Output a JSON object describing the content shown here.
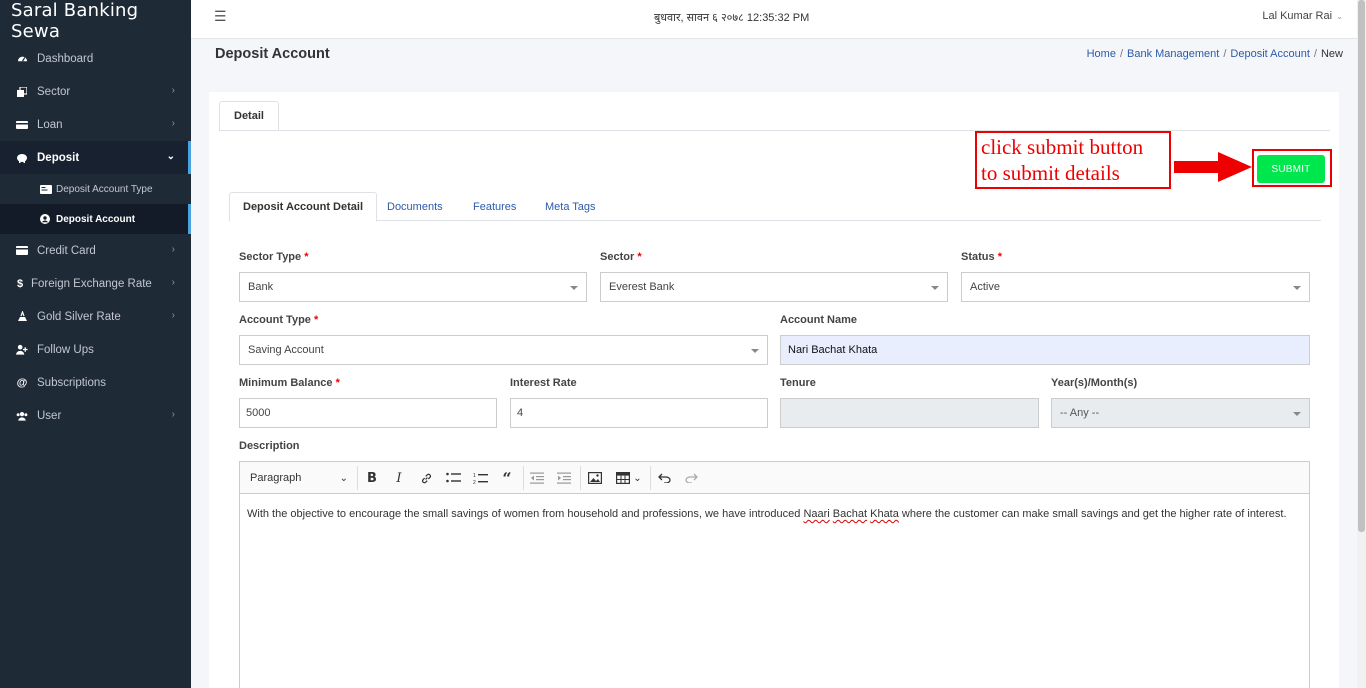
{
  "app": {
    "brand": "Saral Banking Sewa"
  },
  "sidebar": {
    "items": [
      {
        "label": "Dashboard",
        "icon": "dashboard-icon"
      },
      {
        "label": "Sector",
        "icon": "sector-icon"
      },
      {
        "label": "Loan",
        "icon": "loan-icon"
      },
      {
        "label": "Deposit",
        "icon": "piggy-bank-icon",
        "open": true
      },
      {
        "label": "Credit Card",
        "icon": "credit-card-icon"
      },
      {
        "label": "Foreign Exchange Rate",
        "icon": "dollar-icon"
      },
      {
        "label": "Gold Silver Rate",
        "icon": "gold-icon"
      },
      {
        "label": "Follow Ups",
        "icon": "user-plus-icon"
      },
      {
        "label": "Subscriptions",
        "icon": "at-icon"
      },
      {
        "label": "User",
        "icon": "users-icon"
      }
    ],
    "sub_items": [
      {
        "label": "Deposit Account Type",
        "icon": "card-icon"
      },
      {
        "label": "Deposit Account",
        "icon": "user-circle-icon",
        "active": true
      }
    ]
  },
  "topbar": {
    "datetime": "बुधवार, सावन ६ २०७८ 12:35:32 PM",
    "user": "Lal Kumar Rai"
  },
  "page": {
    "title": "Deposit Account",
    "breadcrumb": [
      "Home",
      "Bank Management",
      "Deposit Account",
      "New"
    ]
  },
  "card": {
    "top_tab": "Detail",
    "annotation": {
      "line1": "click  submit  button",
      "line2": "to  submit  details"
    },
    "submit_label": "SUBMIT",
    "tabs": [
      "Deposit Account Detail",
      "Documents",
      "Features",
      "Meta Tags"
    ]
  },
  "form": {
    "sector_type": {
      "label": "Sector Type",
      "value": "Bank"
    },
    "sector": {
      "label": "Sector",
      "value": "Everest Bank"
    },
    "status": {
      "label": "Status",
      "value": "Active"
    },
    "account_type": {
      "label": "Account Type",
      "value": "Saving Account"
    },
    "account_name": {
      "label": "Account Name",
      "value": "Nari Bachat Khata"
    },
    "minimum_balance": {
      "label": "Minimum Balance",
      "value": "5000"
    },
    "interest_rate": {
      "label": "Interest Rate",
      "value": "4"
    },
    "tenure": {
      "label": "Tenure",
      "value": ""
    },
    "year_month": {
      "label": "Year(s)/Month(s)",
      "value": "-- Any --"
    },
    "description": {
      "label": "Description",
      "paragraph_style": "Paragraph",
      "text_before": "With the objective to encourage the small savings of women from household and professions, we have introduced ",
      "w1": "Naari",
      "w2": "Bachat",
      "w3": "Khata",
      "text_after": " where the customer can make small savings and get the higher rate of interest."
    },
    "required_mark": "*"
  },
  "colors": {
    "sidebar": "#1f2a37",
    "accent": "#4aa3df",
    "submit": "#00e64d",
    "annotation": "#ee0000",
    "link": "#2d5ba8"
  }
}
